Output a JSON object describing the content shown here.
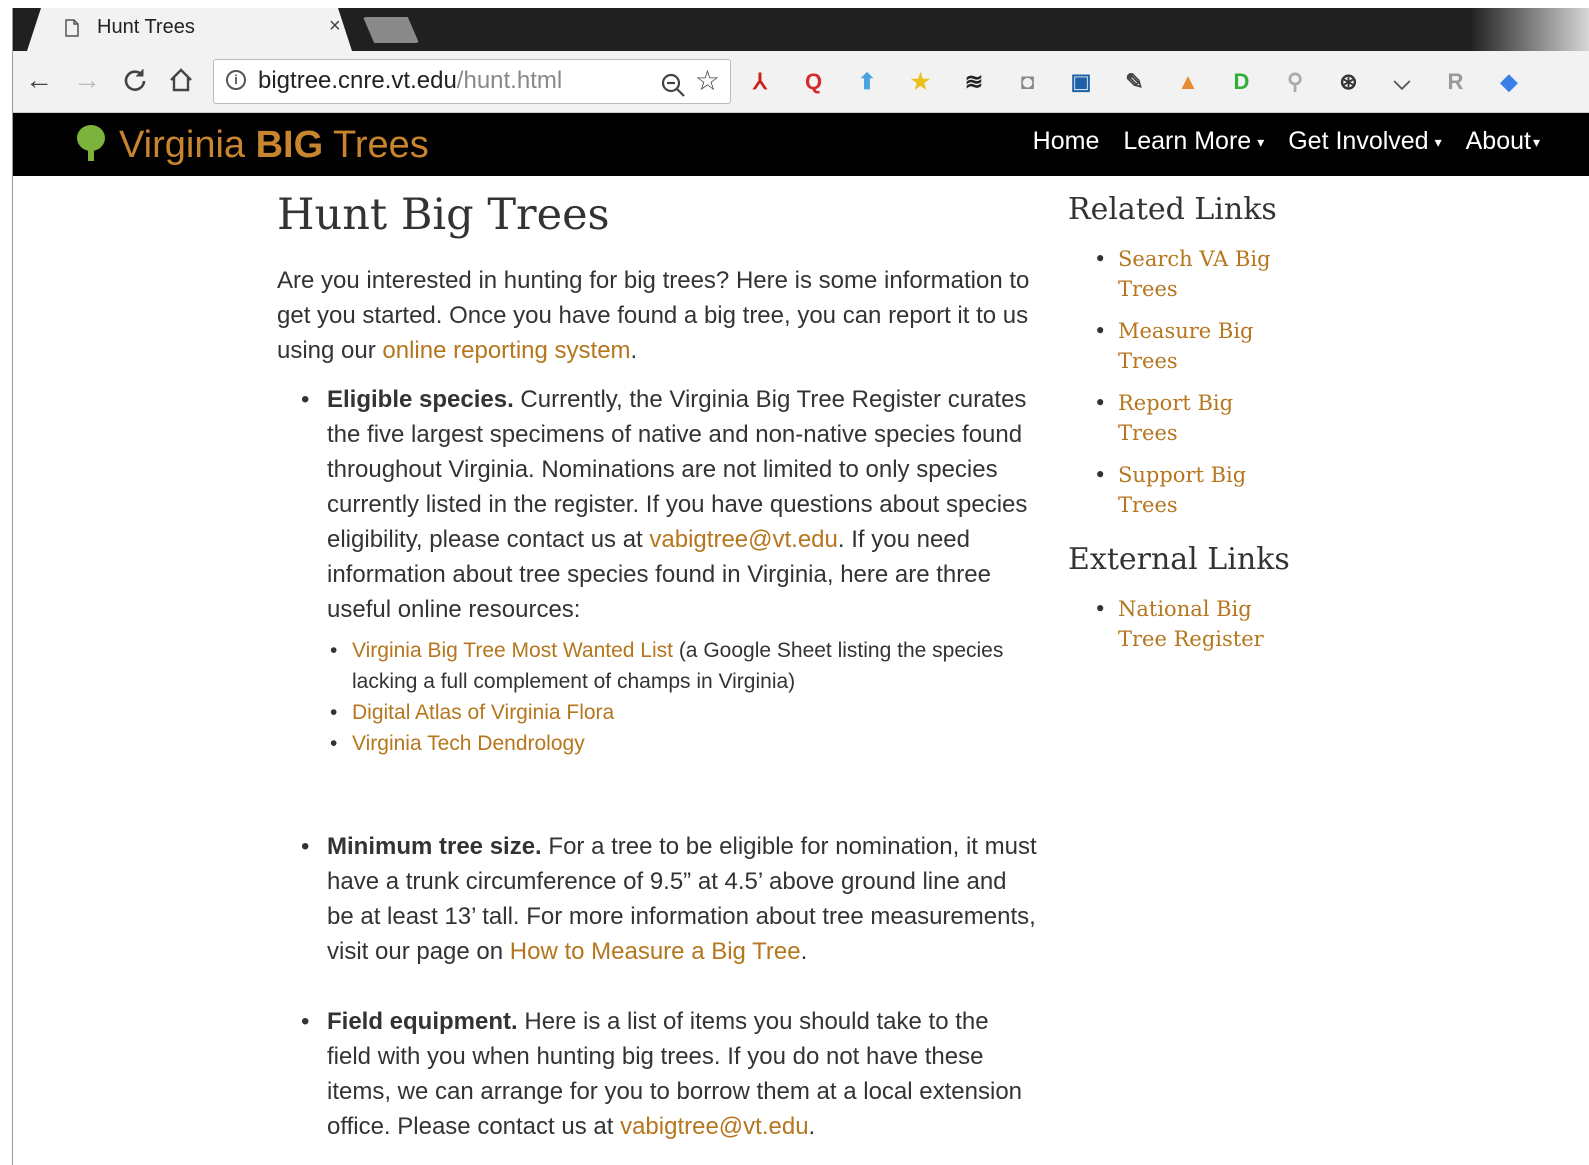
{
  "browser": {
    "tab_title": "Hunt Trees",
    "tab_close": "×",
    "url_host": "bigtree.cnre.vt.edu",
    "url_path": "/hunt.html",
    "nav": {
      "back": "←",
      "forward": "→",
      "reload": "C",
      "home": "⌂"
    },
    "extensions": [
      {
        "name": "pdf-extension-icon",
        "glyph": "⅄",
        "color": "#c9241c"
      },
      {
        "name": "quicktime-extension-icon",
        "glyph": "Q",
        "color": "#d52b2b"
      },
      {
        "name": "upload-arrow-extension-icon",
        "glyph": "⬆",
        "color": "#4aa3df"
      },
      {
        "name": "star-extension-icon",
        "glyph": "★",
        "color": "#e8c11d"
      },
      {
        "name": "layers-extension-icon",
        "glyph": "≋",
        "color": "#222222"
      },
      {
        "name": "screenshot-extension-icon",
        "glyph": "◘",
        "color": "#888888"
      },
      {
        "name": "book-extension-icon",
        "glyph": "▣",
        "color": "#1d5fa8"
      },
      {
        "name": "eyedropper-extension-icon",
        "glyph": "✎",
        "color": "#444444"
      },
      {
        "name": "image-extension-icon",
        "glyph": "▲",
        "color": "#e58a2d"
      },
      {
        "name": "disconnect-extension-icon",
        "glyph": "D",
        "color": "#2fae3a"
      },
      {
        "name": "magnifier-extension-icon",
        "glyph": "⚲",
        "color": "#aaaaaa"
      },
      {
        "name": "steering-extension-icon",
        "glyph": "⊛",
        "color": "#333333"
      },
      {
        "name": "pocket-extension-icon",
        "glyph": "⌵",
        "color": "#555555"
      },
      {
        "name": "r-extension-icon",
        "glyph": "R",
        "color": "#999999"
      },
      {
        "name": "diamond-extension-icon",
        "glyph": "◆",
        "color": "#3b7ee8"
      }
    ]
  },
  "site": {
    "brand_pre": "Virginia ",
    "brand_bold": "BIG",
    "brand_post": " Trees",
    "menu": {
      "home": "Home",
      "learn_more": "Learn More",
      "get_involved": "Get Involved",
      "about": "About"
    },
    "caret": "▾"
  },
  "main": {
    "title": "Hunt Big Trees",
    "intro_text": "Are you interested in hunting for big trees? Here is some information to get you started. Once you have found a big tree, you can report it to us using our ",
    "intro_link": "online reporting system",
    "intro_end": ".",
    "items": {
      "eligible": {
        "label": "Eligible species.",
        "text1": " Currently, the Virginia Big Tree Register curates the five largest specimens of native and non-native species found throughout Virginia. Nominations are not limited to only species currently listed in the register. If you have questions about species eligibility, please contact us at ",
        "email": "vabigtree@vt.edu",
        "text2": ". If you need information about tree species found in Virginia, here are three useful online resources:",
        "resources": {
          "most_wanted_link": "Virginia Big Tree Most Wanted List",
          "most_wanted_note": " (a Google Sheet listing the species lacking a full complement of champs in Virginia)",
          "atlas_link": "Digital Atlas of Virginia Flora",
          "dendrology_link": "Virginia Tech Dendrology"
        }
      },
      "minimum": {
        "label": "Minimum tree size.",
        "text1": " For a tree to be eligible for nomination, it must have a trunk circumference of 9.5” at 4.5’ above ground line and be at least 13’ tall. For more information about tree measurements, visit our page on ",
        "link": "How to Measure a Big Tree",
        "text2": "."
      },
      "equipment": {
        "label": "Field equipment.",
        "text1": " Here is a list of items you should take to the field with you when hunting big trees. If you do not have these items, we can arrange for you to borrow them at a local extension office. Please contact us at ",
        "email": "vabigtree@vt.edu",
        "text2": "."
      }
    }
  },
  "sidebar": {
    "related_title": "Related Links",
    "related": {
      "search": "Search VA Big Trees",
      "measure": "Measure Big Trees",
      "report": "Report Big Trees",
      "support": "Support Big Trees"
    },
    "external_title": "External Links",
    "external": {
      "national": "National Big Tree Register"
    }
  }
}
